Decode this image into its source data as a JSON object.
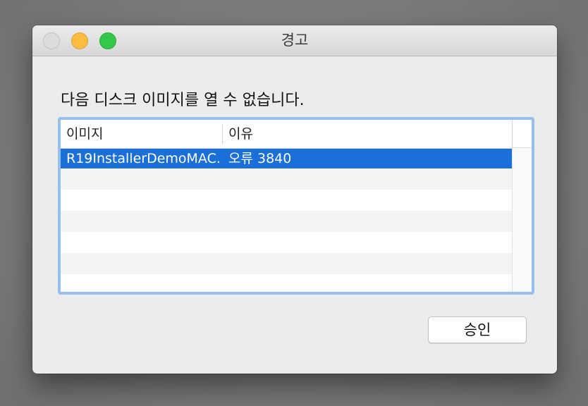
{
  "window": {
    "title": "경고",
    "traffic_lights": {
      "close_color": "#dcdcdc",
      "minimize_color": "#fdbc40",
      "zoom_color": "#34c84a"
    }
  },
  "alert": {
    "message": "다음 디스크 이미지를 열 수 없습니다."
  },
  "table": {
    "columns": [
      "이미지",
      "이유"
    ],
    "rows": [
      {
        "image": "R19InstallerDemoMAC.",
        "reason": "오류 3840",
        "selected": true
      }
    ],
    "empty_rows": 5,
    "selection_color": "#1a6fd8",
    "focus_ring_color": "#96bff0"
  },
  "buttons": {
    "ok_label": "승인"
  }
}
